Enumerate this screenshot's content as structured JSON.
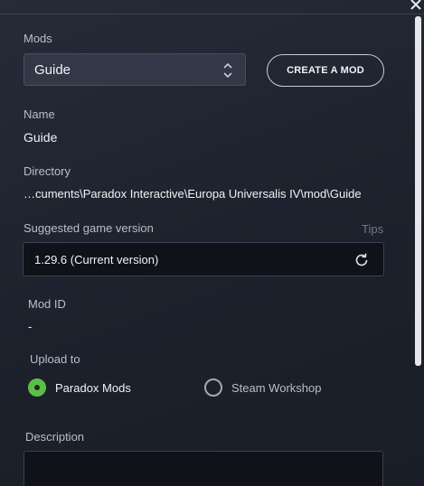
{
  "window": {
    "close_icon": "close-icon"
  },
  "mods": {
    "label": "Mods",
    "selected": "Guide",
    "arrows_icon": "chevron-up-down-icon",
    "create_button": "CREATE A MOD"
  },
  "name": {
    "label": "Name",
    "value": "Guide"
  },
  "directory": {
    "label": "Directory",
    "value": "…cuments\\Paradox Interactive\\Europa Universalis IV\\mod\\Guide"
  },
  "game_version": {
    "label": "Suggested game version",
    "tips": "Tips",
    "value": "1.29.6 (Current version)",
    "reset_icon": "refresh-icon"
  },
  "mod_id": {
    "label": "Mod ID",
    "value": "-"
  },
  "upload": {
    "label": "Upload to",
    "options": [
      {
        "label": "Paradox Mods",
        "checked": true
      },
      {
        "label": "Steam Workshop",
        "checked": false
      }
    ]
  },
  "description": {
    "label": "Description",
    "value": ""
  },
  "colors": {
    "accent_green": "#5bbf46",
    "background": "#1f2430",
    "field_dark": "#0f1218"
  }
}
